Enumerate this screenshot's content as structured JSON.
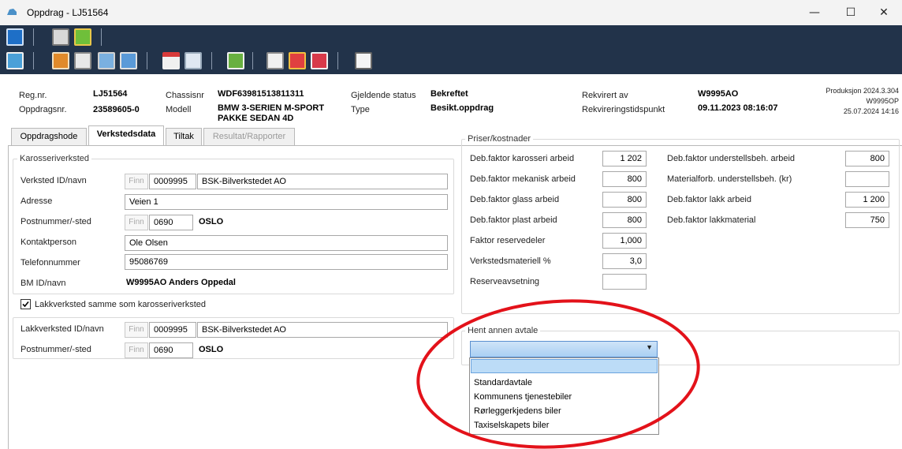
{
  "window": {
    "title": "Oppdrag - LJ51564",
    "minimize_glyph": "—",
    "maximize_glyph": "☐",
    "close_glyph": "✕"
  },
  "toolbar": {
    "icons": [
      "save-icon",
      "print-icon",
      "add-document-icon",
      "grid-icon",
      "edit-icon",
      "open-icon",
      "copy-icon",
      "transfer-icon",
      "list-icon",
      "window-icon",
      "export-icon",
      "font-icon",
      "forward-icon",
      "refresh-icon",
      "percent-icon"
    ]
  },
  "header": {
    "regnr_label": "Reg.nr.",
    "regnr_value": "LJ51564",
    "oppdragsnr_label": "Oppdragsnr.",
    "oppdragsnr_value": "23589605-0",
    "chassisnr_label": "Chassisnr",
    "chassisnr_value": "WDF63981513811311",
    "modell_label": "Modell",
    "modell_value_1": "BMW 3-SERIEN M-SPORT",
    "modell_value_2": "PAKKE SEDAN 4D",
    "status_label": "Gjeldende status",
    "status_value": "Bekreftet",
    "type_label": "Type",
    "type_value": "Besikt.oppdrag",
    "rekvirert_label": "Rekvirert av",
    "rekvirert_value": "W9995AO",
    "tidspunkt_label": "Rekvireringstidspunkt",
    "tidspunkt_value": "09.11.2023 08:16:07",
    "produksjon": "Produksjon 2024.3.304",
    "user_code": "W9995OP",
    "date": "25.07.2024 14:16"
  },
  "tabs": [
    "Oppdragshode",
    "Verkstedsdata",
    "Tiltak",
    "Resultat/Rapporter"
  ],
  "karosseri": {
    "group_title": "Karosseriverksted",
    "verksted_label": "Verksted ID/navn",
    "finn": "Finn",
    "verksted_id": "0009995",
    "verksted_navn": "BSK-Bilverkstedet AO",
    "adresse_label": "Adresse",
    "adresse": "Veien 1",
    "post_label": "Postnummer/-sted",
    "postnr": "0690",
    "sted": "OSLO",
    "kontakt_label": "Kontaktperson",
    "kontakt": "Ole Olsen",
    "telefon_label": "Telefonnummer",
    "telefon": "95086769",
    "bm_label": "BM ID/navn",
    "bm_value": "W9995AO  Anders Oppedal",
    "same_checkbox_label": "Lakkverksted samme som karosseriverksted"
  },
  "lakk": {
    "verksted_label": "Lakkverksted ID/navn",
    "finn": "Finn",
    "verksted_id": "0009995",
    "verksted_navn": "BSK-Bilverkstedet AO",
    "post_label": "Postnummer/-sted",
    "postnr": "0690",
    "sted": "OSLO"
  },
  "priser": {
    "group_title": "Priser/kostnader",
    "left": [
      {
        "label": "Deb.faktor karosseri arbeid",
        "value": "1 202"
      },
      {
        "label": "Deb.faktor mekanisk arbeid",
        "value": "800"
      },
      {
        "label": "Deb.faktor glass arbeid",
        "value": "800"
      },
      {
        "label": "Deb.faktor plast arbeid",
        "value": "800"
      },
      {
        "label": "Faktor reservedeler",
        "value": "1,000"
      },
      {
        "label": "Verkstedsmateriell %",
        "value": "3,0"
      },
      {
        "label": "Reserveavsetning",
        "value": ""
      }
    ],
    "right": [
      {
        "label": "Deb.faktor understellsbeh. arbeid",
        "value": "800"
      },
      {
        "label": "Materialforb. understellsbeh. (kr)",
        "value": ""
      },
      {
        "label": "Deb.faktor lakk arbeid",
        "value": "1 200"
      },
      {
        "label": "Deb.faktor lakkmaterial",
        "value": "750"
      }
    ]
  },
  "avtale": {
    "group_title": "Hent annen avtale",
    "selected": "",
    "options": [
      "",
      "Standardavtale",
      "Kommunens tjenestebiler",
      "Rørleggerkjedens biler",
      "Taxiselskapets biler"
    ]
  },
  "colors": {
    "toolbar_bg": "#22334a",
    "highlight_ellipse": "#e3121a",
    "combo_selected": "#bcdcf7"
  }
}
